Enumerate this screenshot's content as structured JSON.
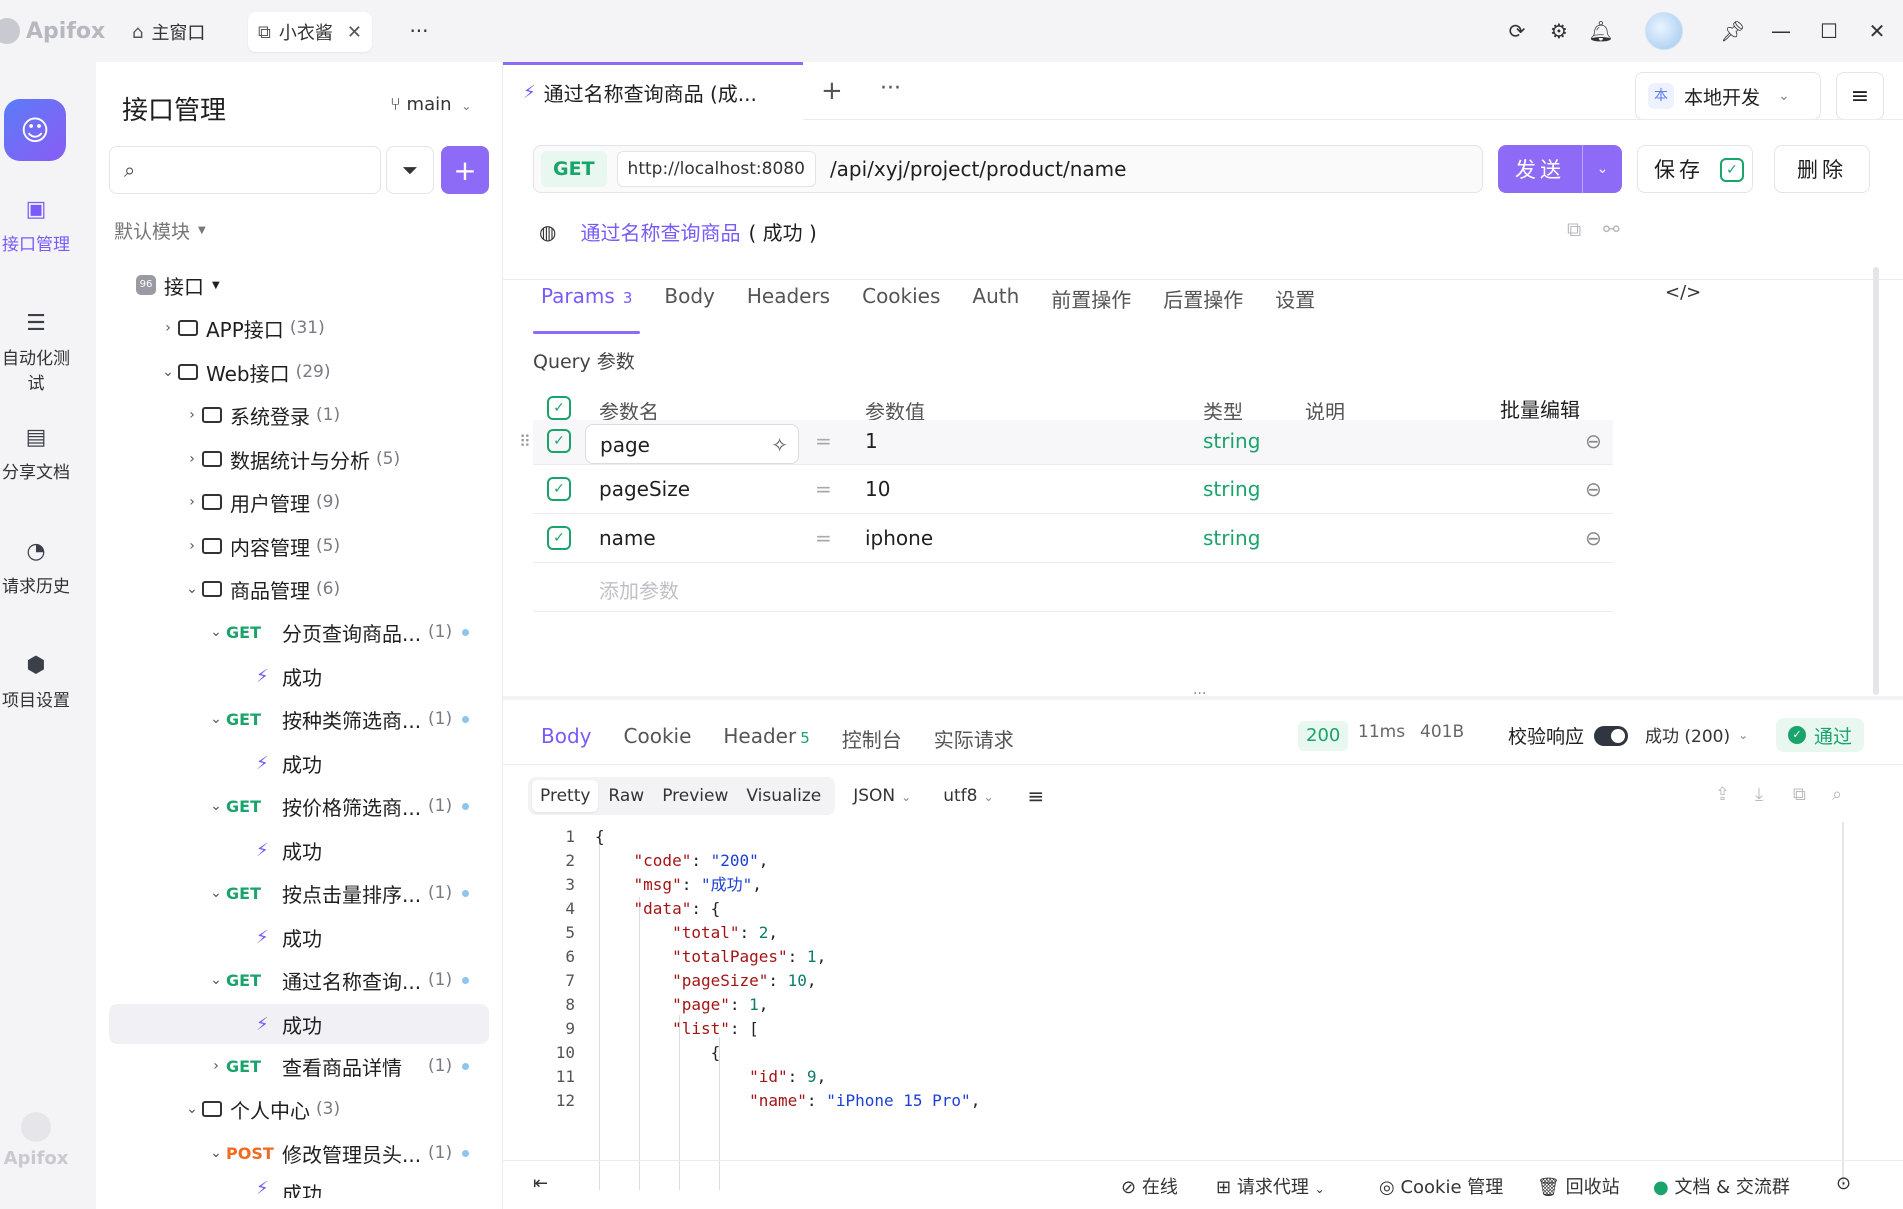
{
  "titlebar": {
    "app_name": "Apifox",
    "tabs": [
      {
        "icon": "home-icon",
        "label": "主窗口"
      },
      {
        "icon": "external-window-icon",
        "label": "小衣酱"
      }
    ],
    "more_label": "···"
  },
  "rail": {
    "items": [
      {
        "icon": "api-icon",
        "label": "接口管理"
      },
      {
        "icon": "automation-icon",
        "label": "自动化测试"
      },
      {
        "icon": "book-icon",
        "label": "分享文档"
      },
      {
        "icon": "clock-icon",
        "label": "请求历史"
      },
      {
        "icon": "settings-icon",
        "label": "项目设置"
      }
    ],
    "bottom_logo": "Apifox"
  },
  "sidebar": {
    "title": "接口管理",
    "branch": "main",
    "module": "默认模块",
    "root": "接口",
    "tree": [
      {
        "kind": "folder",
        "label": "APP接口",
        "count": "(31)"
      },
      {
        "kind": "folder",
        "label": "Web接口",
        "count": "(29)"
      },
      {
        "kind": "folder",
        "label": "系统登录",
        "count": "(1)"
      },
      {
        "kind": "folder",
        "label": "数据统计与分析",
        "count": "(5)"
      },
      {
        "kind": "folder",
        "label": "用户管理",
        "count": "(9)"
      },
      {
        "kind": "folder",
        "label": "内容管理",
        "count": "(5)"
      },
      {
        "kind": "folder",
        "label": "商品管理",
        "count": "(6)"
      },
      {
        "kind": "api",
        "method": "GET",
        "label": "分页查询商品...",
        "count": "(1)"
      },
      {
        "kind": "case",
        "label": "成功"
      },
      {
        "kind": "api",
        "method": "GET",
        "label": "按种类筛选商...",
        "count": "(1)"
      },
      {
        "kind": "case",
        "label": "成功"
      },
      {
        "kind": "api",
        "method": "GET",
        "label": "按价格筛选商...",
        "count": "(1)"
      },
      {
        "kind": "case",
        "label": "成功"
      },
      {
        "kind": "api",
        "method": "GET",
        "label": "按点击量排序...",
        "count": "(1)"
      },
      {
        "kind": "case",
        "label": "成功"
      },
      {
        "kind": "api",
        "method": "GET",
        "label": "通过名称查询...",
        "count": "(1)"
      },
      {
        "kind": "case",
        "label": "成功"
      },
      {
        "kind": "api",
        "method": "GET",
        "label": "查看商品详情",
        "count": "(1)"
      },
      {
        "kind": "folder",
        "label": "个人中心",
        "count": "(3)"
      },
      {
        "kind": "api",
        "method": "POST",
        "label": "修改管理员头...",
        "count": "(1)"
      },
      {
        "kind": "case",
        "label": "成功"
      }
    ]
  },
  "main": {
    "doc_tab": "通过名称查询商品 (成...",
    "env": {
      "badge": "本",
      "label": "本地开发"
    },
    "request": {
      "method": "GET",
      "host": "http://localhost:8080",
      "path": "/api/xyj/project/product/name",
      "send": "发送",
      "save": "保存",
      "delete": "删除"
    },
    "case_name": "通过名称查询商品",
    "case_status": "( 成功 )",
    "req_tabs": [
      "Params",
      "Body",
      "Headers",
      "Cookies",
      "Auth",
      "前置操作",
      "后置操作",
      "设置"
    ],
    "params_count": "3",
    "query_label": "Query 参数",
    "table_headers": {
      "name": "参数名",
      "value": "参数值",
      "type": "类型",
      "desc": "说明",
      "bulk": "批量编辑"
    },
    "params": [
      {
        "name": "page",
        "value": "1",
        "type": "string"
      },
      {
        "name": "pageSize",
        "value": "10",
        "type": "string"
      },
      {
        "name": "name",
        "value": "iphone",
        "type": "string"
      }
    ],
    "add_param": "添加参数",
    "resp_tabs": [
      "Body",
      "Cookie",
      "Header",
      "控制台",
      "实际请求"
    ],
    "resp_header_count": "5",
    "status": "200",
    "time": "11ms",
    "size": "401B",
    "validate_label": "校验响应",
    "validate_select": "成功 (200)",
    "pass_label": "通过",
    "view_modes": [
      "Pretty",
      "Raw",
      "Preview",
      "Visualize"
    ],
    "format": "JSON",
    "encoding": "utf8",
    "code_lines": [
      "1",
      "2",
      "3",
      "4",
      "5",
      "6",
      "7",
      "8",
      "9",
      "10",
      "11",
      "12"
    ],
    "footer": {
      "online": "在线",
      "proxy": "请求代理",
      "cookie": "Cookie 管理",
      "trash": "回收站",
      "docs": "文档 & 交流群"
    }
  }
}
